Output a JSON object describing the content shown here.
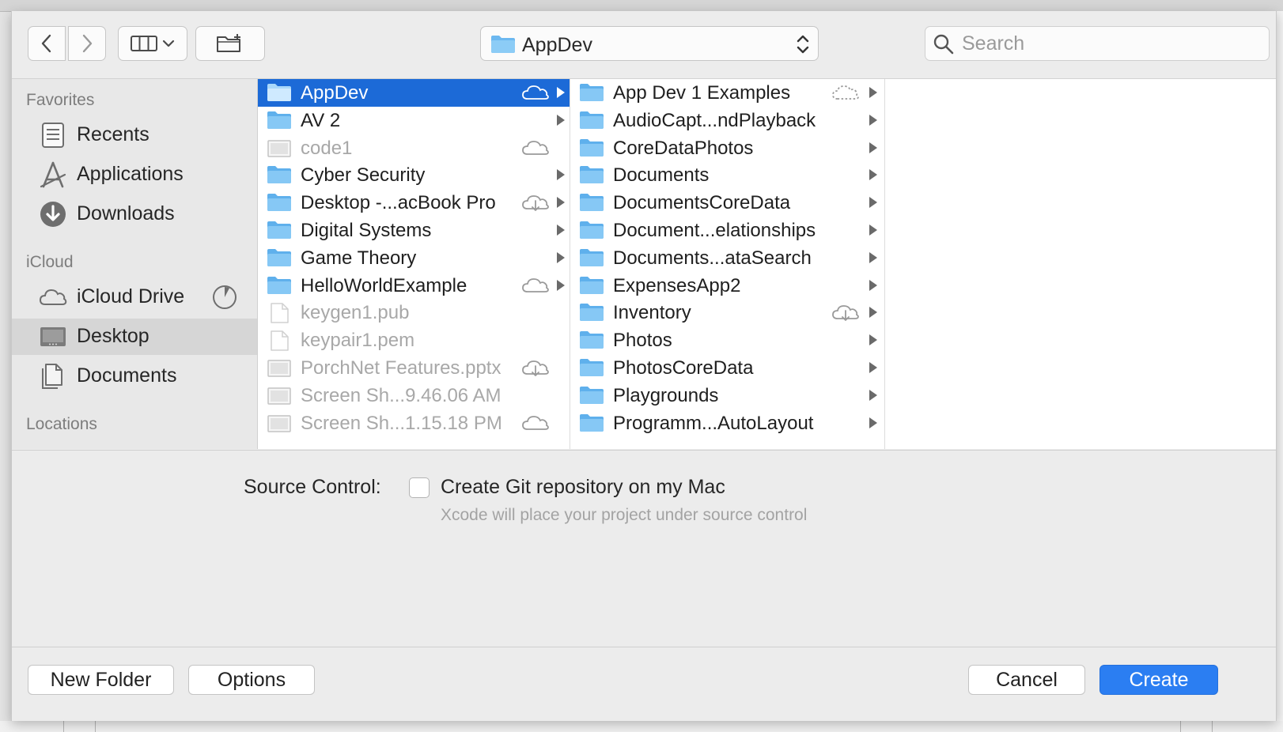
{
  "toolbar": {
    "back_icon": "chevron-left-icon",
    "forward_icon": "chevron-right-icon",
    "view_icon": "column-view-icon",
    "new_folder_icon": "new-folder-icon",
    "location": "AppDev",
    "search_placeholder": "Search"
  },
  "sidebar": {
    "favorites_heading": "Favorites",
    "favorites": [
      {
        "label": "Recents",
        "icon": "recents-icon"
      },
      {
        "label": "Applications",
        "icon": "applications-icon"
      },
      {
        "label": "Downloads",
        "icon": "downloads-icon"
      }
    ],
    "icloud_heading": "iCloud",
    "icloud": [
      {
        "label": "iCloud Drive",
        "icon": "icloud-icon",
        "extra_icon": "storage-pie-icon"
      },
      {
        "label": "Desktop",
        "icon": "desktop-icon",
        "selected": true
      },
      {
        "label": "Documents",
        "icon": "documents-icon"
      }
    ],
    "locations_heading": "Locations"
  },
  "column1": [
    {
      "name": "AppDev",
      "type": "folder",
      "cloud": "cloud",
      "arrow": true,
      "selected": true
    },
    {
      "name": "AV 2",
      "type": "folder",
      "arrow": true
    },
    {
      "name": "code1",
      "type": "file",
      "cloud": "cloud",
      "dim": true
    },
    {
      "name": "Cyber Security",
      "type": "folder",
      "arrow": true
    },
    {
      "name": "Desktop -...acBook Pro",
      "type": "folder",
      "cloud": "cloud-download",
      "arrow": true
    },
    {
      "name": "Digital Systems",
      "type": "folder",
      "arrow": true
    },
    {
      "name": "Game Theory",
      "type": "folder",
      "arrow": true
    },
    {
      "name": "HelloWorldExample",
      "type": "folder",
      "cloud": "cloud",
      "arrow": true
    },
    {
      "name": "keygen1.pub",
      "type": "doc",
      "dim": true
    },
    {
      "name": "keypair1.pem",
      "type": "doc",
      "dim": true
    },
    {
      "name": "PorchNet Features.pptx",
      "type": "file",
      "cloud": "cloud-download",
      "dim": true
    },
    {
      "name": "Screen Sh...9.46.06 AM",
      "type": "file",
      "dim": true
    },
    {
      "name": "Screen Sh...1.15.18 PM",
      "type": "file",
      "cloud": "cloud",
      "dim": true
    }
  ],
  "column2": [
    {
      "name": "App Dev 1 Examples",
      "type": "folder",
      "cloud": "cloud-dashed",
      "arrow": true
    },
    {
      "name": "AudioCapt...ndPlayback",
      "type": "folder",
      "arrow": true
    },
    {
      "name": "CoreDataPhotos",
      "type": "folder",
      "arrow": true
    },
    {
      "name": "Documents",
      "type": "folder",
      "arrow": true
    },
    {
      "name": "DocumentsCoreData",
      "type": "folder",
      "arrow": true
    },
    {
      "name": "Document...elationships",
      "type": "folder",
      "arrow": true
    },
    {
      "name": "Documents...ataSearch",
      "type": "folder",
      "arrow": true
    },
    {
      "name": "ExpensesApp2",
      "type": "folder",
      "arrow": true
    },
    {
      "name": "Inventory",
      "type": "folder",
      "cloud": "cloud-download",
      "arrow": true
    },
    {
      "name": "Photos",
      "type": "folder",
      "arrow": true
    },
    {
      "name": "PhotosCoreData",
      "type": "folder",
      "arrow": true
    },
    {
      "name": "Playgrounds",
      "type": "folder",
      "arrow": true
    },
    {
      "name": "Programm...AutoLayout",
      "type": "folder",
      "arrow": true
    }
  ],
  "options": {
    "source_control_label": "Source Control:",
    "checkbox_label": "Create Git repository on my Mac",
    "checkbox_checked": false,
    "help_text": "Xcode will place your project under source control"
  },
  "buttons": {
    "new_folder": "New Folder",
    "options": "Options",
    "cancel": "Cancel",
    "create": "Create"
  },
  "colors": {
    "selection": "#1c6ad7",
    "primary_button": "#2b7ef2",
    "folder": "#6cb8f0"
  }
}
